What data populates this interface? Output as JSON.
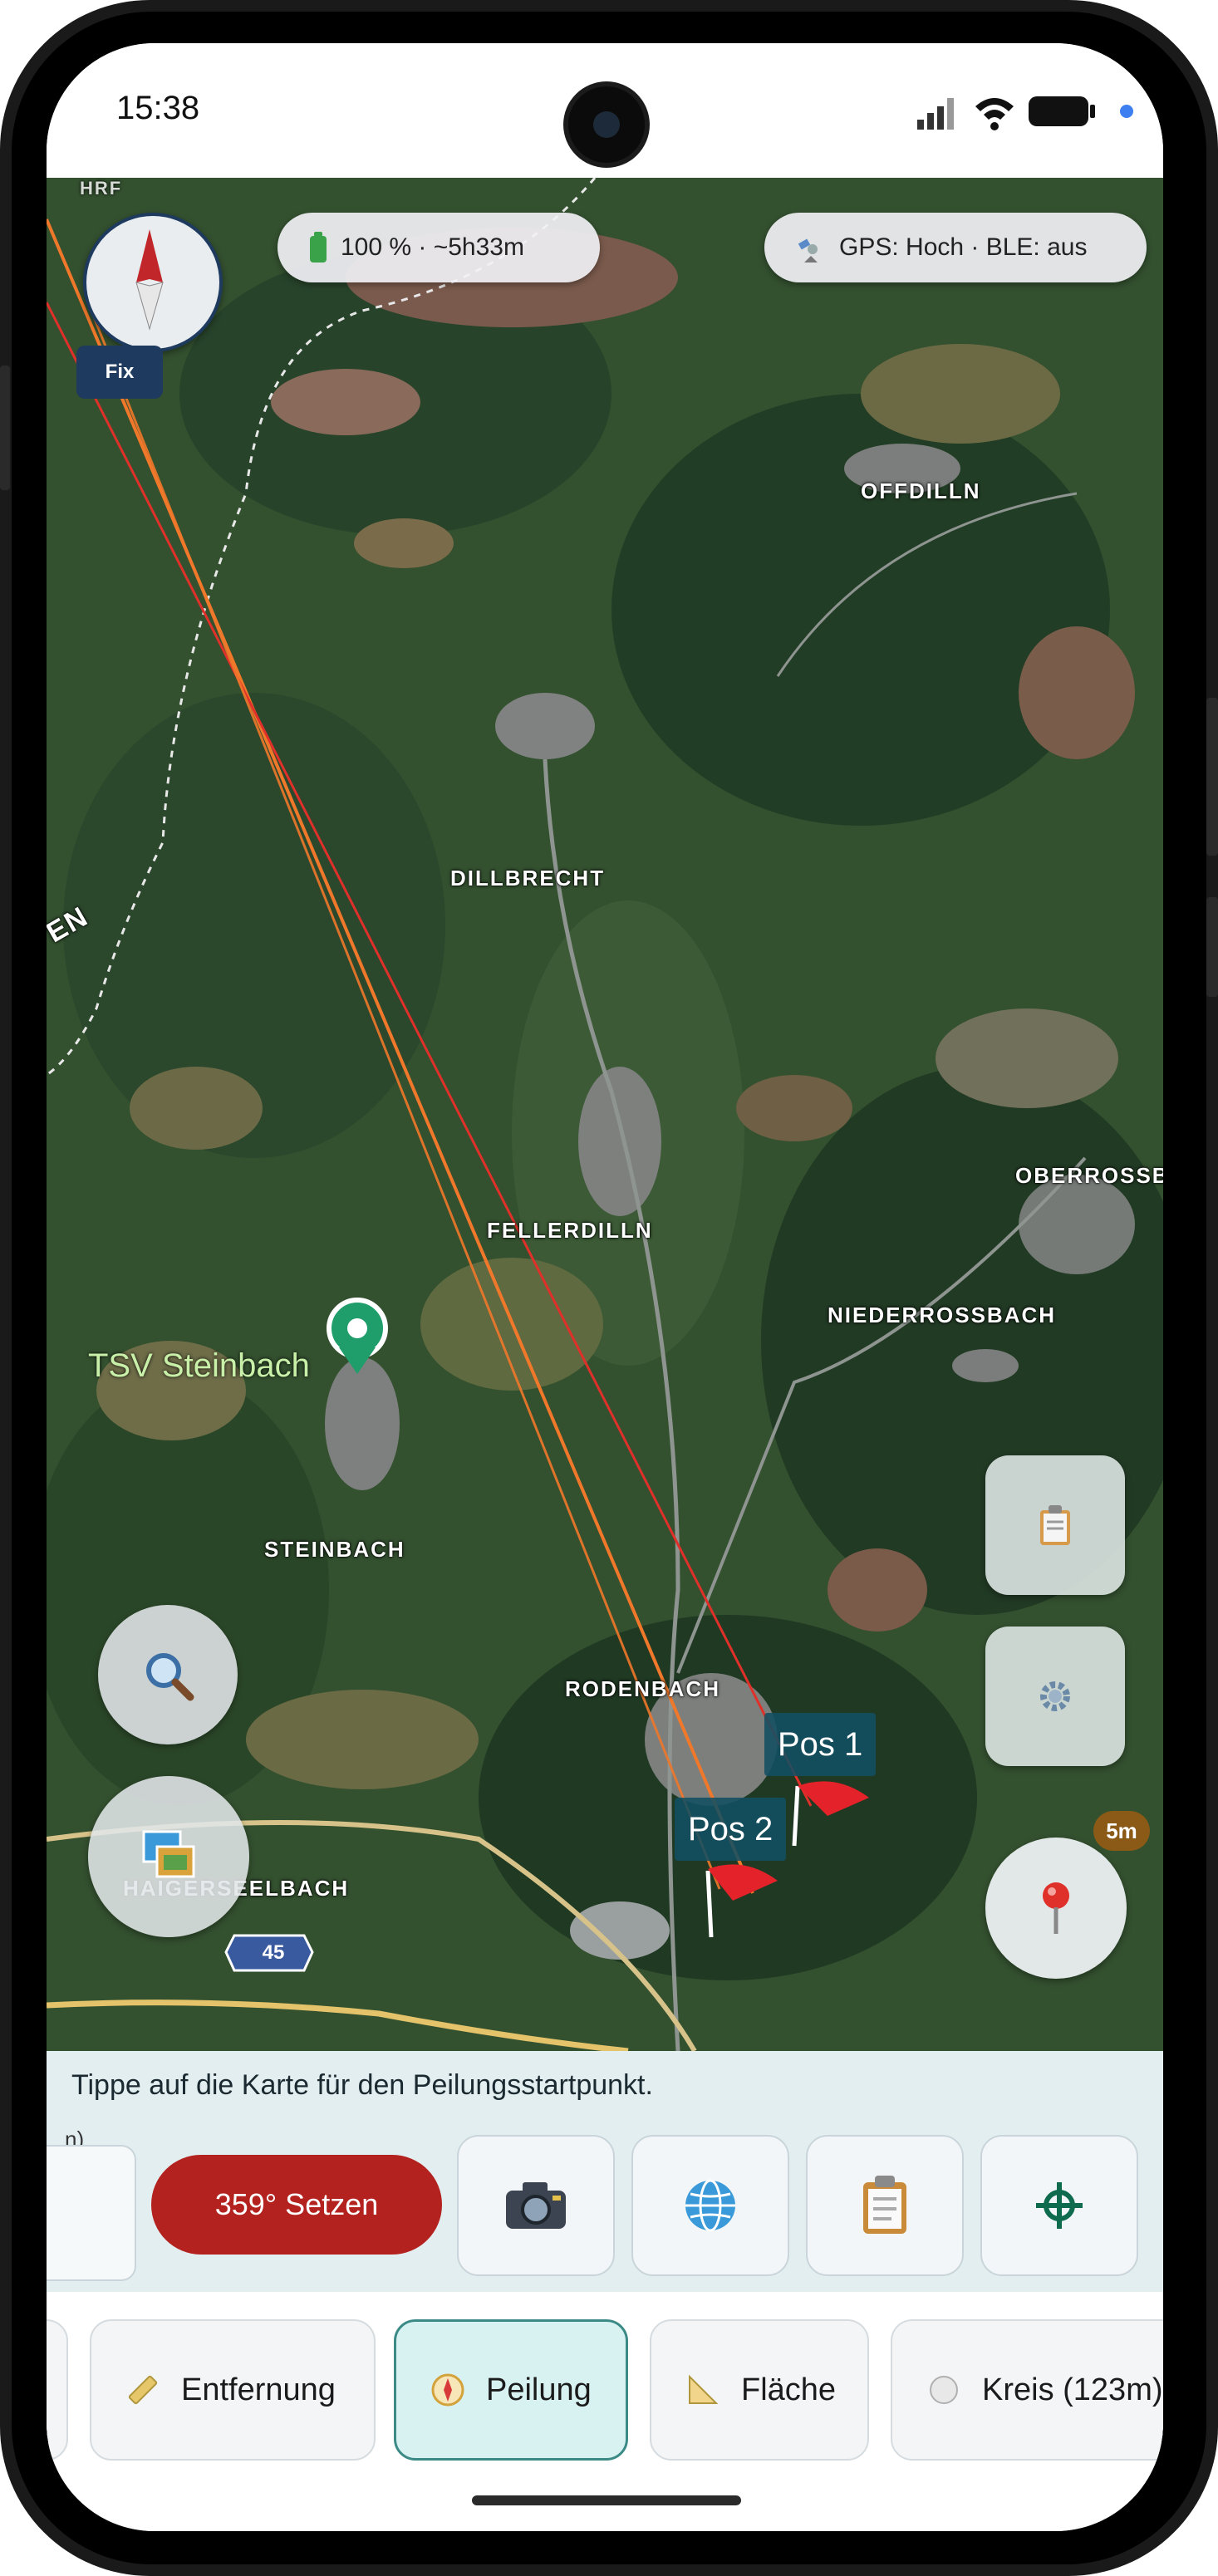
{
  "status_bar": {
    "time": "15:38"
  },
  "map": {
    "battery_pill": "100 % · ~5h33m",
    "gps_pill": "GPS: Hoch · BLE: aus",
    "compass_badge": "Fix",
    "places": {
      "offdilln": "OFFDILLN",
      "dillbrecht": "DILLBRECHT",
      "fellerdilln": "FELLERDILLN",
      "oberrossbach": "OBERROSSB",
      "niederrossbach": "NIEDERROSSBACH",
      "steinbach": "STEINBACH",
      "rodenbach": "RODENBACH",
      "haigerseelbach": "HAIGERSEELBACH",
      "edge_text": "EN",
      "corner_text": "HRF"
    },
    "poi_label": "TSV Steinbach",
    "road_number": "45",
    "markers": [
      {
        "label": "Pos 1"
      },
      {
        "label": "Pos 2"
      }
    ],
    "location_badge": "5m",
    "colors": {
      "orange_line": "#f0782a",
      "red_line": "#e0302a",
      "marker_flag": "#e3222a",
      "poi_green": "#1f9d6a"
    }
  },
  "panel": {
    "hint": "Tippe auf die Karte für den Peilungsstartpunkt.",
    "stub_text": "n)",
    "set_button": "359° Setzen",
    "buttons": [
      {
        "name": "camera",
        "icon": "camera-icon"
      },
      {
        "name": "globe",
        "icon": "globe-icon"
      },
      {
        "name": "clipboard",
        "icon": "clipboard-icon"
      },
      {
        "name": "crosshair",
        "icon": "crosshair-icon"
      }
    ]
  },
  "tabs": [
    {
      "label": "Entfernung",
      "icon": "ruler-icon"
    },
    {
      "label": "Peilung",
      "icon": "compass-icon",
      "active": true
    },
    {
      "label": "Fläche",
      "icon": "triangle-ruler-icon"
    },
    {
      "label": "Kreis (123m)",
      "icon": "circle-icon"
    }
  ]
}
